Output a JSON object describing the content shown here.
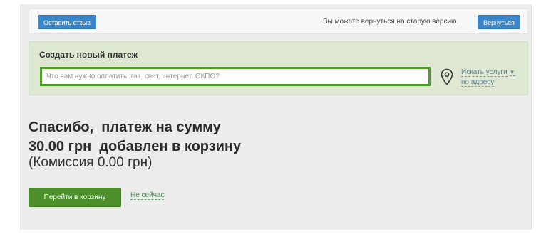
{
  "topbar": {
    "feedback_label": "Оставить отзыв",
    "old_version_text": "Вы можете вернуться на старую версию.",
    "return_label": "Вернуться"
  },
  "payment": {
    "title": "Создать новый платеж",
    "search_placeholder": "Что вам нужно оплатить: газ, свет, интернет, ОКПО?",
    "address_link_line1": "Искать услуги",
    "address_link_line2": "по адресу",
    "pin_icon": "location-pin-icon"
  },
  "confirmation": {
    "line1": "Спасибо,  платеж на сумму",
    "line2": "30.00 грн  добавлен в корзину",
    "commission": "(Комиссия 0.00 грн)",
    "cart_button": "Перейти в корзину",
    "not_now": "Не сейчас"
  },
  "colors": {
    "accent_blue": "#3a86c8",
    "accent_green": "#4c8f2b",
    "panel_green": "#dfe8d3"
  }
}
